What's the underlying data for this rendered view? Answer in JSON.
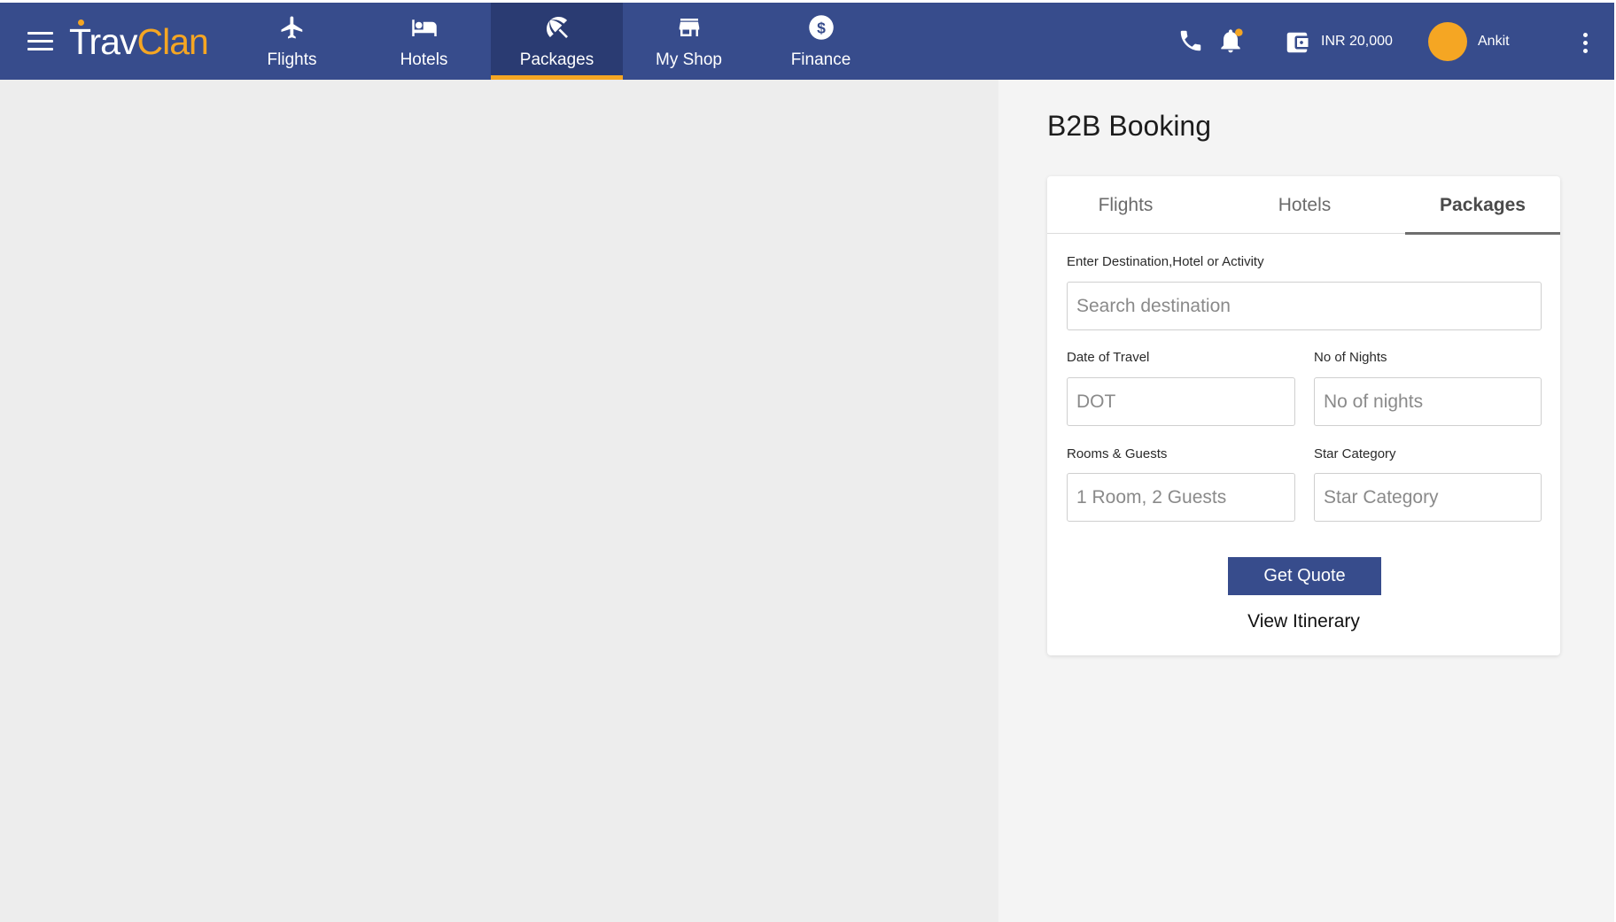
{
  "app": {
    "logo_part1": "Trav",
    "logo_part2": "Clan"
  },
  "nav": {
    "tabs": [
      {
        "label": "Flights",
        "icon": "airplane-icon",
        "active": false
      },
      {
        "label": "Hotels",
        "icon": "bed-icon",
        "active": false
      },
      {
        "label": "Packages",
        "icon": "beach-umbrella-icon",
        "active": true
      },
      {
        "label": "My Shop",
        "icon": "storefront-icon",
        "active": false
      },
      {
        "label": "Finance",
        "icon": "dollar-circle-icon",
        "active": false
      }
    ],
    "wallet_amount": "INR 20,000",
    "user_name": "Ankit"
  },
  "page": {
    "title": "B2B Booking"
  },
  "booking": {
    "tabs": [
      {
        "label": "Flights",
        "active": false
      },
      {
        "label": "Hotels",
        "active": false
      },
      {
        "label": "Packages",
        "active": true
      }
    ],
    "destination_label": "Enter Destination,Hotel or Activity",
    "destination_placeholder": "Search destination",
    "date_label": "Date of Travel",
    "date_placeholder": "DOT",
    "nights_label": "No of Nights",
    "nights_placeholder": "No of nights",
    "rooms_label": "Rooms & Guests",
    "rooms_placeholder": "1 Room, 2 Guests",
    "star_label": "Star Category",
    "star_placeholder": "Star Category",
    "quote_button": "Get Quote",
    "itinerary_link": "View Itinerary"
  },
  "colors": {
    "primary": "#374c8c",
    "primary_dark": "#2a3b72",
    "accent": "#f5a623",
    "panel_left": "#ededed",
    "panel_right": "#f4f4f4"
  }
}
